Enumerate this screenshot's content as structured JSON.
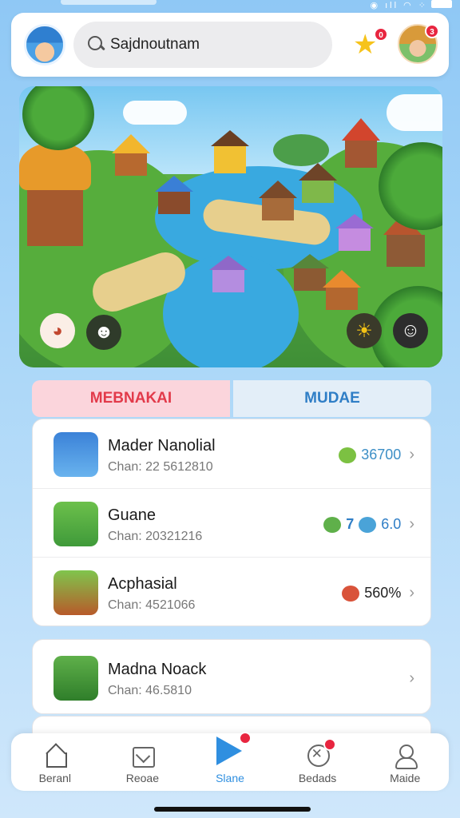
{
  "header": {
    "search_text": "Sajdnoutnam",
    "notification_badge": "0",
    "friend_badge": "3"
  },
  "tabs": [
    {
      "label": "MEBNAKAI",
      "color": "#e23a4a"
    },
    {
      "label": "MUDAE",
      "color": "#2f7ec6"
    }
  ],
  "list": [
    {
      "title": "Mader Nanolial",
      "subtitle": "Chan: 22 5612810",
      "reward": "36700",
      "reward_color": "#3d8fc6",
      "gem_color": "#7cc142"
    },
    {
      "title": "Guane",
      "subtitle": "Chan: 20321216",
      "reward": "7",
      "reward_extra": "6.0",
      "reward_color": "#2f7ec6",
      "gem_color": "#5fb04a"
    },
    {
      "title": "Acphasial",
      "subtitle": "Chan: 4521066",
      "reward": "560%",
      "reward_color": "#222",
      "gem_color": "#d9533a"
    },
    {
      "title": "Madna Noack",
      "subtitle": "Chan: 46.5810",
      "reward": "",
      "reward_color": "#222",
      "gem_color": ""
    }
  ],
  "nav": [
    {
      "label": "Beranl",
      "icon": "home-icon"
    },
    {
      "label": "Reoae",
      "icon": "check-box-icon"
    },
    {
      "label": "Slane",
      "icon": "play-icon",
      "active": true
    },
    {
      "label": "Bedads",
      "icon": "target-icon"
    },
    {
      "label": "Maide",
      "icon": "user-icon"
    }
  ],
  "colors": {
    "accent": "#2f8fe0",
    "badge": "#e8253f"
  }
}
